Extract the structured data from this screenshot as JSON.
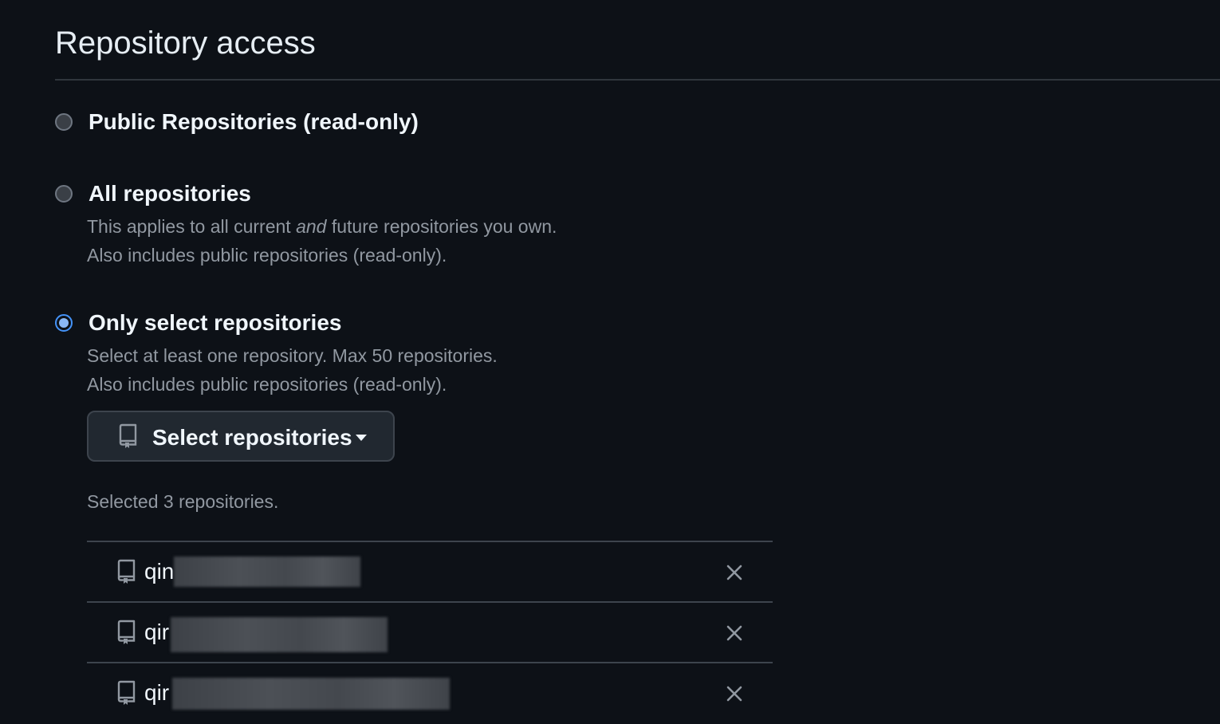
{
  "section": {
    "title": "Repository access"
  },
  "options": [
    {
      "label": "Public Repositories (read-only)",
      "checked": false
    },
    {
      "label": "All repositories",
      "checked": false,
      "desc_line1_pre": "This applies to all current ",
      "desc_line1_em": "and",
      "desc_line1_post": " future repositories you own.",
      "desc_line2": "Also includes public repositories (read-only)."
    },
    {
      "label": "Only select repositories",
      "checked": true,
      "desc_line1": "Select at least one repository. Max 50 repositories.",
      "desc_line2": "Also includes public repositories (read-only)."
    }
  ],
  "select_button": {
    "label": "Select repositories",
    "icon": "repo-icon",
    "caret_icon": "triangle-down-icon"
  },
  "selected_count_text": "Selected 3 repositories.",
  "repositories": [
    {
      "name_visible": "qin",
      "redacted": true
    },
    {
      "name_visible": "qir",
      "redacted": true
    },
    {
      "name_visible": "qir",
      "redacted": true
    }
  ],
  "colors": {
    "background": "#0d1117",
    "text_primary": "#f0f6fc",
    "text_muted": "#9198a1",
    "border": "#30363d",
    "radio_checked": "#4493f8"
  }
}
